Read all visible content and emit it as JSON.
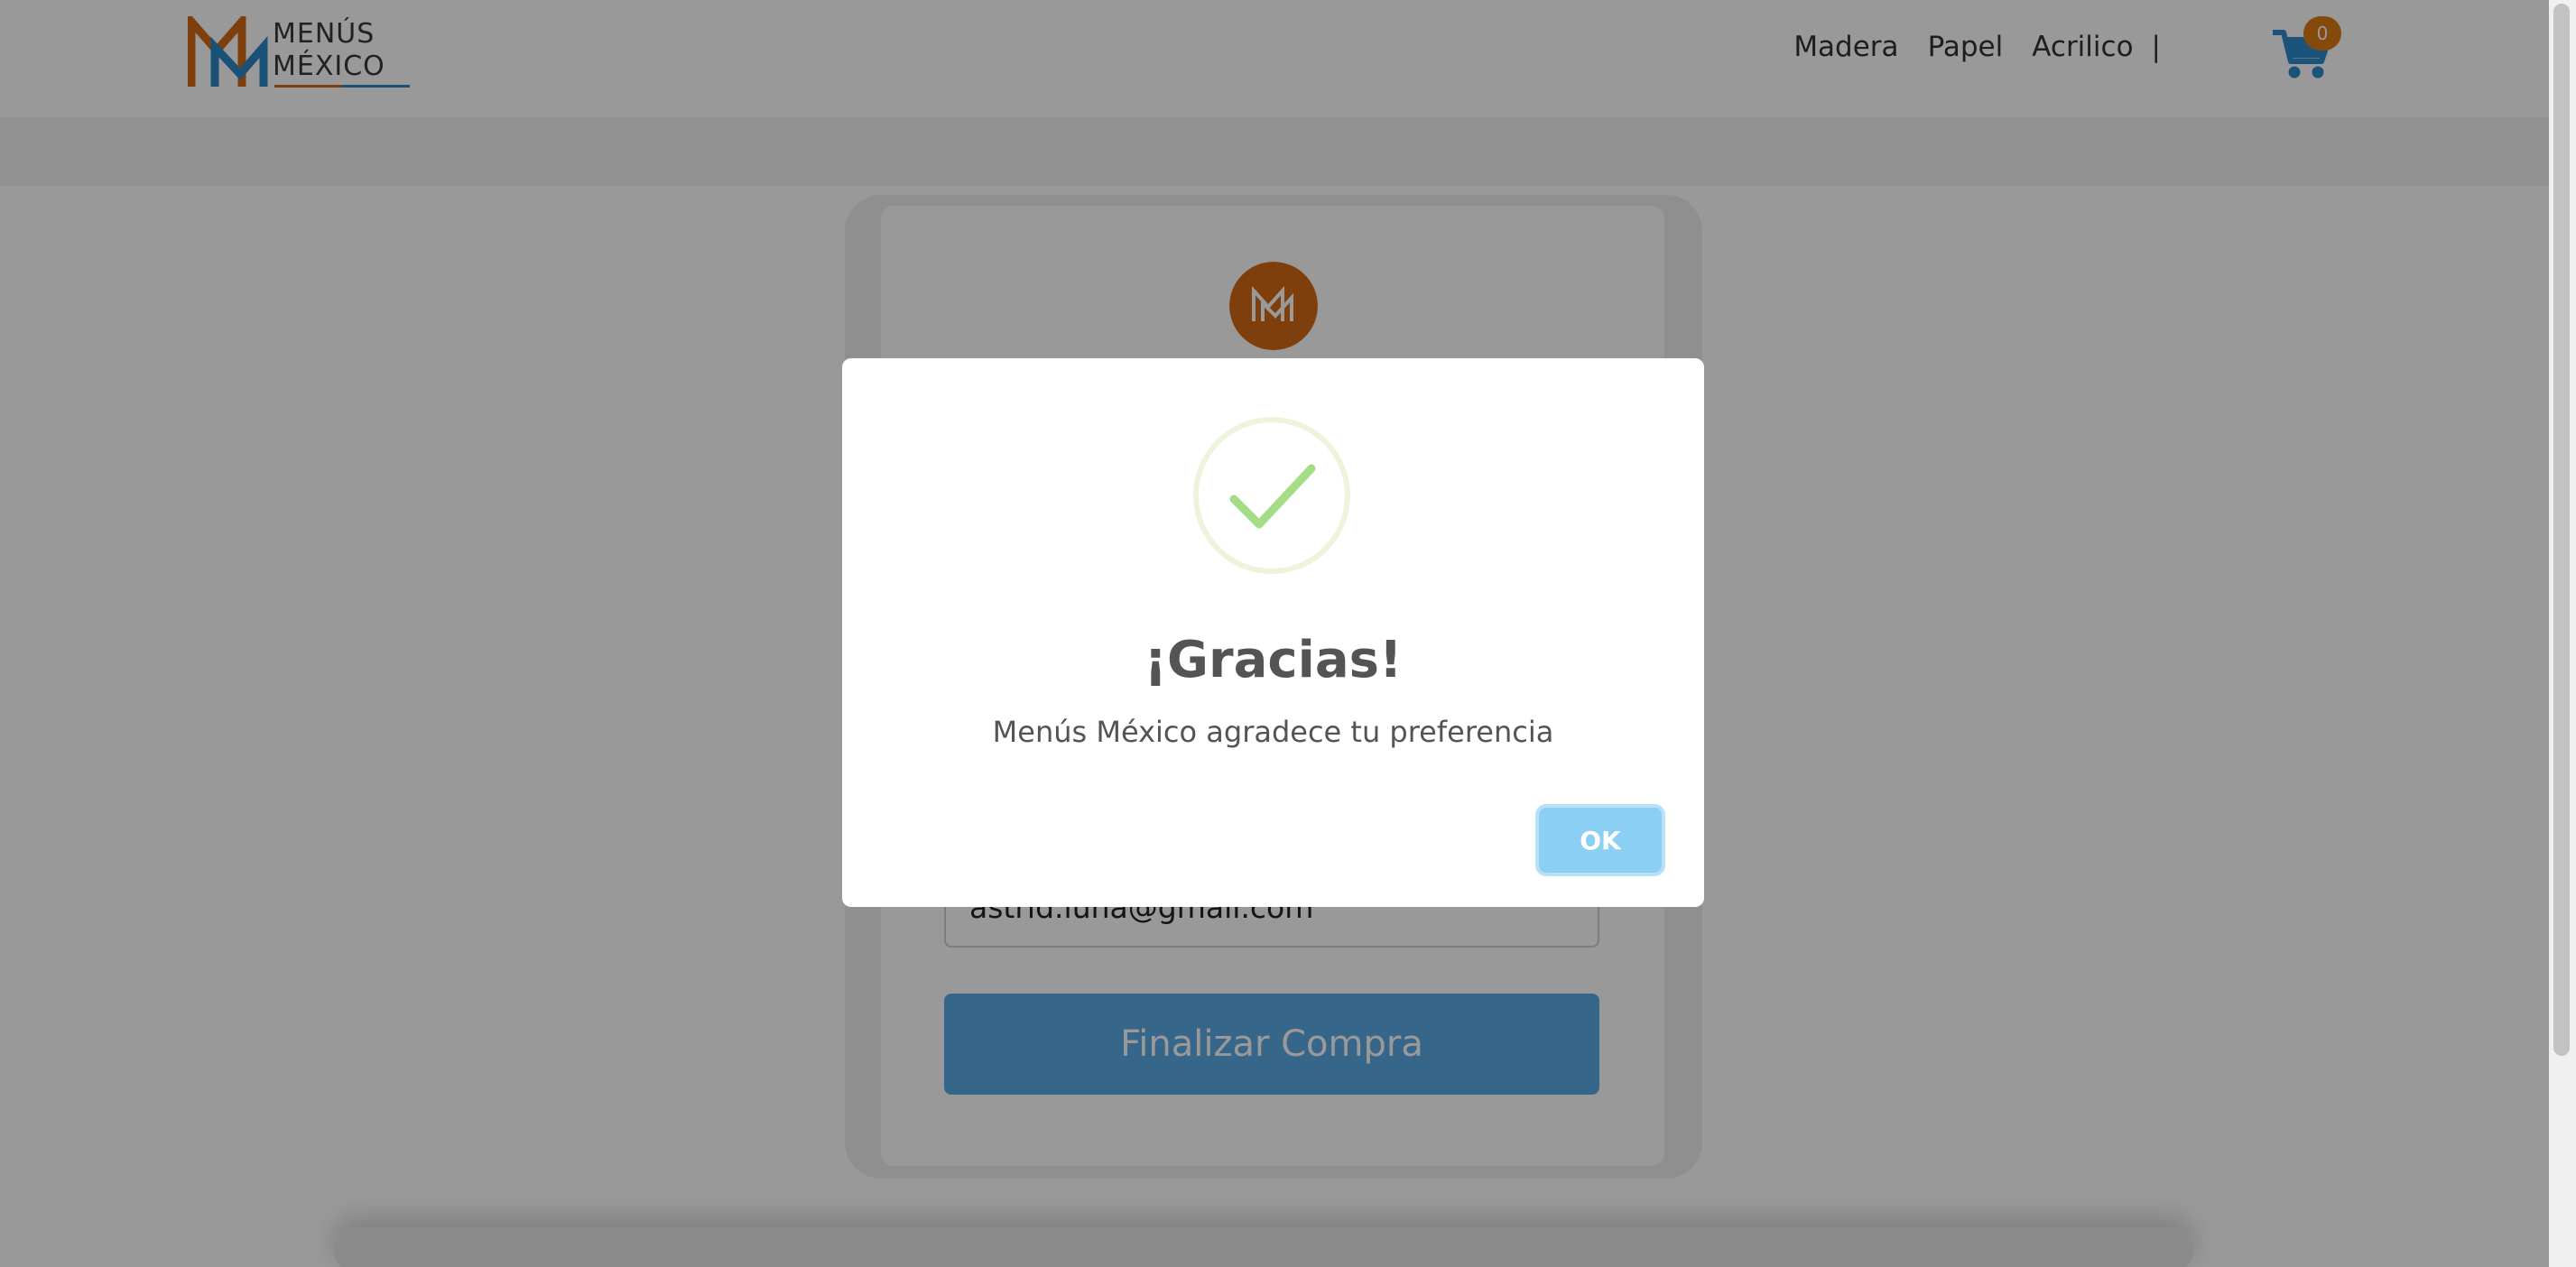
{
  "header": {
    "logo_line1": "MENÚS",
    "logo_line2": "MÉXICO",
    "nav": [
      {
        "label": "Madera"
      },
      {
        "label": "Papel"
      },
      {
        "label": "Acrilico"
      }
    ],
    "separator": "|",
    "cart": {
      "icon": "shopping-cart-icon",
      "count": "0"
    }
  },
  "card": {
    "logo_icon": "menus-mexico-monogram-icon",
    "email_value": "astrid.luna@gmail.com",
    "finalize_label": "Finalizar Compra"
  },
  "modal": {
    "icon": "success-check-icon",
    "title": "¡Gracias!",
    "text": "Menús México agradece tu preferencia",
    "ok_label": "OK"
  },
  "colors": {
    "brand_orange": "#d46a17",
    "brand_blue": "#2e85c6",
    "finalize_button": "#5aabe6",
    "ok_button": "#8ccff5",
    "success_check": "#a5dc86",
    "success_ring": "#ecf4dc",
    "badge": "#e07a15",
    "cart_icon": "#2e8acc"
  }
}
